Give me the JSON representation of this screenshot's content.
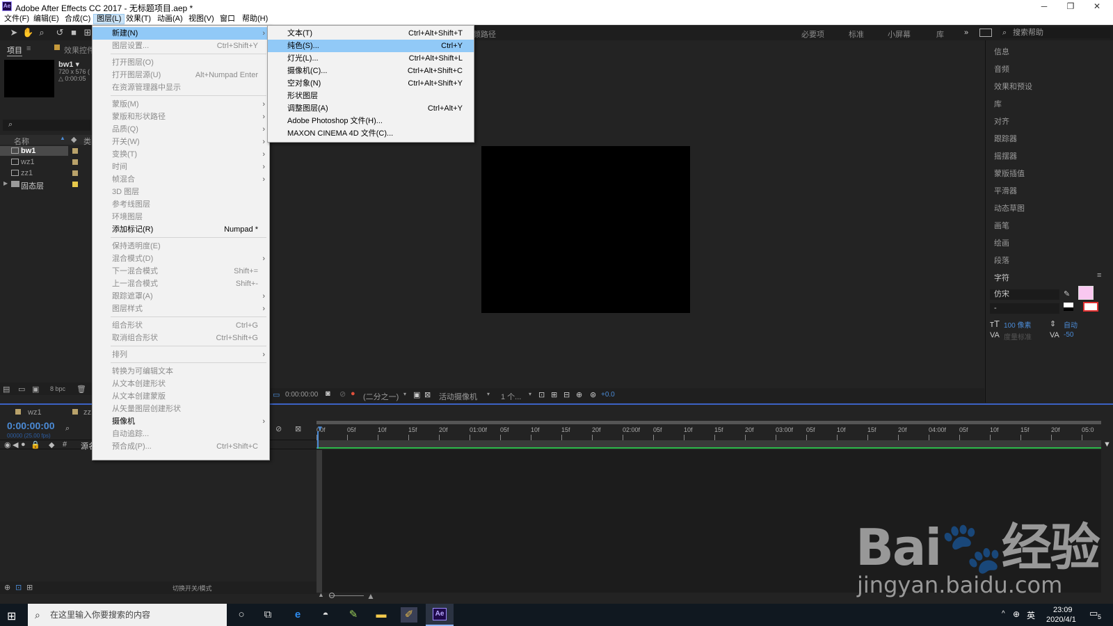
{
  "window": {
    "title": "Adobe After Effects CC 2017 - 无标题项目.aep *",
    "logo": "Ae",
    "controls": [
      "─",
      "❐",
      "✕"
    ]
  },
  "menubar": [
    "文件(F)",
    "编辑(E)",
    "合成(C)",
    "图层(L)",
    "效果(T)",
    "动画(A)",
    "视图(V)",
    "窗口",
    "帮助(H)"
  ],
  "toolbar": {
    "workspaces": [
      "必要项",
      "标准",
      "小屏幕",
      "库"
    ],
    "more": "»",
    "search_placeholder": "搜索帮助",
    "path_label": "颜路径"
  },
  "project": {
    "tabs": [
      "项目",
      "效果控件"
    ],
    "selected_name": "bw1 ▾",
    "meta1": "720 x 576 (",
    "meta2": "△ 0:00:05",
    "columns": [
      "名称",
      "类"
    ],
    "items": [
      "bw1",
      "wz1",
      "zz1",
      "固态层"
    ],
    "bpc": "8 bpc"
  },
  "right_panel": {
    "items": [
      "信息",
      "音频",
      "效果和预设",
      "库",
      "对齐",
      "跟踪器",
      "摇摆器",
      "蒙版插值",
      "平滑器",
      "动态草图",
      "画笔",
      "绘画",
      "段落",
      "字符"
    ],
    "font": "仿宋",
    "style": "-",
    "size": "100 像素",
    "leading": "自动",
    "kerning": "度量标准",
    "tracking": "-50",
    "fill_color": "#f9c8f0"
  },
  "viewer": {
    "timecode": "0:00:00:00",
    "resolution": "(二分之一)",
    "camera": "活动摄像机",
    "views": "1 个...",
    "exposure": "+0.0"
  },
  "timeline": {
    "tabs": [
      "wz1",
      "zz1"
    ],
    "timecode": "0:00:00:00",
    "fps": "00000 (25.00 fps)",
    "source_col": "源名",
    "switch_label": "切换开关/模式",
    "ruler": [
      "00f",
      "05f",
      "10f",
      "15f",
      "20f",
      "01:00f",
      "05f",
      "10f",
      "15f",
      "20f",
      "02:00f",
      "05f",
      "10f",
      "15f",
      "20f",
      "03:00f",
      "05f",
      "10f",
      "15f",
      "20f",
      "04:00f",
      "05f",
      "10f",
      "15f",
      "20f",
      "05:0"
    ]
  },
  "layer_menu": {
    "items": [
      {
        "label": "新建(N)",
        "shortcut": "",
        "submenu": true,
        "state": "hl"
      },
      {
        "label": "图层设置...",
        "shortcut": "Ctrl+Shift+Y",
        "submenu": false,
        "state": "disabled"
      },
      {
        "sep": true
      },
      {
        "label": "打开图层(O)",
        "shortcut": "",
        "submenu": false,
        "state": "disabled"
      },
      {
        "label": "打开图层源(U)",
        "shortcut": "Alt+Numpad Enter",
        "submenu": false,
        "state": "disabled"
      },
      {
        "label": "在资源管理器中显示",
        "shortcut": "",
        "submenu": false,
        "state": "disabled"
      },
      {
        "sep": true
      },
      {
        "label": "蒙版(M)",
        "shortcut": "",
        "submenu": true,
        "state": "disabled"
      },
      {
        "label": "蒙版和形状路径",
        "shortcut": "",
        "submenu": true,
        "state": "disabled"
      },
      {
        "label": "品质(Q)",
        "shortcut": "",
        "submenu": true,
        "state": "disabled"
      },
      {
        "label": "开关(W)",
        "shortcut": "",
        "submenu": true,
        "state": "disabled"
      },
      {
        "label": "变换(T)",
        "shortcut": "",
        "submenu": true,
        "state": "disabled"
      },
      {
        "label": "时间",
        "shortcut": "",
        "submenu": true,
        "state": "disabled"
      },
      {
        "label": "帧混合",
        "shortcut": "",
        "submenu": true,
        "state": "disabled"
      },
      {
        "label": "3D 图层",
        "shortcut": "",
        "submenu": false,
        "state": "disabled"
      },
      {
        "label": "参考线图层",
        "shortcut": "",
        "submenu": false,
        "state": "disabled"
      },
      {
        "label": "环境图层",
        "shortcut": "",
        "submenu": false,
        "state": "disabled"
      },
      {
        "label": "添加标记(R)",
        "shortcut": "Numpad *",
        "submenu": false,
        "state": "enabled"
      },
      {
        "sep": true
      },
      {
        "label": "保持透明度(E)",
        "shortcut": "",
        "submenu": false,
        "state": "disabled"
      },
      {
        "label": "混合模式(D)",
        "shortcut": "",
        "submenu": true,
        "state": "disabled"
      },
      {
        "label": "下一混合模式",
        "shortcut": "Shift+=",
        "submenu": false,
        "state": "disabled"
      },
      {
        "label": "上一混合模式",
        "shortcut": "Shift+-",
        "submenu": false,
        "state": "disabled"
      },
      {
        "label": "跟踪遮罩(A)",
        "shortcut": "",
        "submenu": true,
        "state": "disabled"
      },
      {
        "label": "图层样式",
        "shortcut": "",
        "submenu": true,
        "state": "disabled"
      },
      {
        "sep": true
      },
      {
        "label": "组合形状",
        "shortcut": "Ctrl+G",
        "submenu": false,
        "state": "disabled"
      },
      {
        "label": "取消组合形状",
        "shortcut": "Ctrl+Shift+G",
        "submenu": false,
        "state": "disabled"
      },
      {
        "sep": true
      },
      {
        "label": "排列",
        "shortcut": "",
        "submenu": true,
        "state": "disabled"
      },
      {
        "sep": true
      },
      {
        "label": "转换为可编辑文本",
        "shortcut": "",
        "submenu": false,
        "state": "disabled"
      },
      {
        "label": "从文本创建形状",
        "shortcut": "",
        "submenu": false,
        "state": "disabled"
      },
      {
        "label": "从文本创建蒙版",
        "shortcut": "",
        "submenu": false,
        "state": "disabled"
      },
      {
        "label": "从矢量图层创建形状",
        "shortcut": "",
        "submenu": false,
        "state": "disabled"
      },
      {
        "label": "摄像机",
        "shortcut": "",
        "submenu": true,
        "state": "enabled"
      },
      {
        "label": "自动追踪...",
        "shortcut": "",
        "submenu": false,
        "state": "disabled"
      },
      {
        "label": "预合成(P)...",
        "shortcut": "Ctrl+Shift+C",
        "submenu": false,
        "state": "disabled"
      }
    ]
  },
  "new_submenu": {
    "items": [
      {
        "label": "文本(T)",
        "shortcut": "Ctrl+Alt+Shift+T",
        "state": "enabled"
      },
      {
        "label": "纯色(S)...",
        "shortcut": "Ctrl+Y",
        "state": "hl"
      },
      {
        "label": "灯光(L)...",
        "shortcut": "Ctrl+Alt+Shift+L",
        "state": "enabled"
      },
      {
        "label": "摄像机(C)...",
        "shortcut": "Ctrl+Alt+Shift+C",
        "state": "enabled"
      },
      {
        "label": "空对象(N)",
        "shortcut": "Ctrl+Alt+Shift+Y",
        "state": "enabled"
      },
      {
        "label": "形状图层",
        "shortcut": "",
        "state": "enabled"
      },
      {
        "label": "调整图层(A)",
        "shortcut": "Ctrl+Alt+Y",
        "state": "enabled"
      },
      {
        "label": "Adobe Photoshop 文件(H)...",
        "shortcut": "",
        "state": "enabled"
      },
      {
        "label": "MAXON CINEMA 4D 文件(C)...",
        "shortcut": "",
        "state": "enabled"
      }
    ]
  },
  "taskbar": {
    "search_placeholder": "在这里输入你要搜索的内容",
    "time": "23:09",
    "date": "2020/4/1",
    "ime": "英",
    "notif_count": "5"
  },
  "watermark": {
    "brand": "Bai🐾经验",
    "url": "jingyan.baidu.com"
  }
}
